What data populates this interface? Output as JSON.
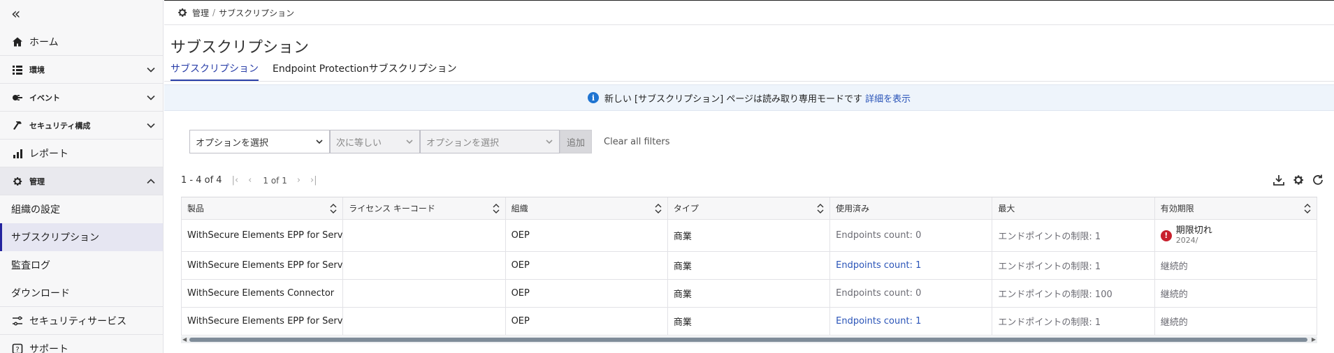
{
  "sidebar": {
    "collapse_icon": "double-chevron-left-icon",
    "items": [
      {
        "label": "ホーム",
        "icon": "home-icon"
      },
      {
        "label": "環境",
        "icon": "list-icon"
      },
      {
        "label": "イベント",
        "icon": "plug-icon"
      },
      {
        "label": "セキュリティ構成",
        "icon": "hammer-icon"
      },
      {
        "label": "レポート",
        "icon": "bar-chart-icon"
      },
      {
        "label": "管理",
        "icon": "gear-icon"
      }
    ],
    "subitems": [
      {
        "label": "組織の設定"
      },
      {
        "label": "サブスクリプション"
      },
      {
        "label": "監査ログ"
      },
      {
        "label": "ダウンロード"
      }
    ],
    "after": [
      {
        "label": "セキュリティサービス",
        "icon": "sliders-icon"
      },
      {
        "label": "サポート",
        "icon": "help-icon"
      }
    ]
  },
  "breadcrumb": {
    "root": "管理",
    "separator": "/",
    "current": "サブスクリプション"
  },
  "page": {
    "title": "サブスクリプション"
  },
  "tabs": [
    {
      "label": "サブスクリプション",
      "active": true
    },
    {
      "label": "Endpoint Protectionサブスクリプション",
      "active": false
    }
  ],
  "banner": {
    "text": "新しい [サブスクリプション] ページは読み取り専用モードです",
    "link": "詳細を表示"
  },
  "filters": {
    "field_placeholder": "オプションを選択",
    "operator": "次に等しい",
    "value_placeholder": "オプションを選択",
    "add_label": "追加",
    "clear_label": "Clear all filters"
  },
  "pager": {
    "range": "1 - 4 of 4",
    "page": "1 of 1"
  },
  "table": {
    "headers": [
      "製品",
      "ライセンス キーコード",
      "組織",
      "タイプ",
      "使用済み",
      "最大",
      "有効期限"
    ],
    "rows": [
      {
        "product": "WithSecure Elements EPP for Serve",
        "key": "",
        "org": "OEP",
        "type": "商業",
        "used": "Endpoints count: 0",
        "used_link": false,
        "max": "エンドポイントの制限: 1",
        "expiry": "期限切れ",
        "expiry_sub": "2024/",
        "expired": true
      },
      {
        "product": "WithSecure Elements EPP for Serve",
        "key": "",
        "org": "OEP",
        "type": "商業",
        "used": "Endpoints count: 1",
        "used_link": true,
        "max": "エンドポイントの制限: 1",
        "expiry": "継続的",
        "expiry_sub": "",
        "expired": false
      },
      {
        "product": "WithSecure Elements Connector",
        "key": "",
        "org": "OEP",
        "type": "商業",
        "used": "Endpoints count: 0",
        "used_link": false,
        "max": "エンドポイントの制限: 100",
        "expiry": "継続的",
        "expiry_sub": "",
        "expired": false
      },
      {
        "product": "WithSecure Elements EPP for Serve",
        "key": "",
        "org": "OEP",
        "type": "商業",
        "used": "Endpoints count: 1",
        "used_link": true,
        "max": "エンドポイントの制限: 1",
        "expiry": "継続的",
        "expiry_sub": "",
        "expired": false
      }
    ]
  },
  "colors": {
    "accent": "#2a3fa8",
    "link": "#2a54b8",
    "error": "#c8202d",
    "info": "#1f74d1"
  }
}
